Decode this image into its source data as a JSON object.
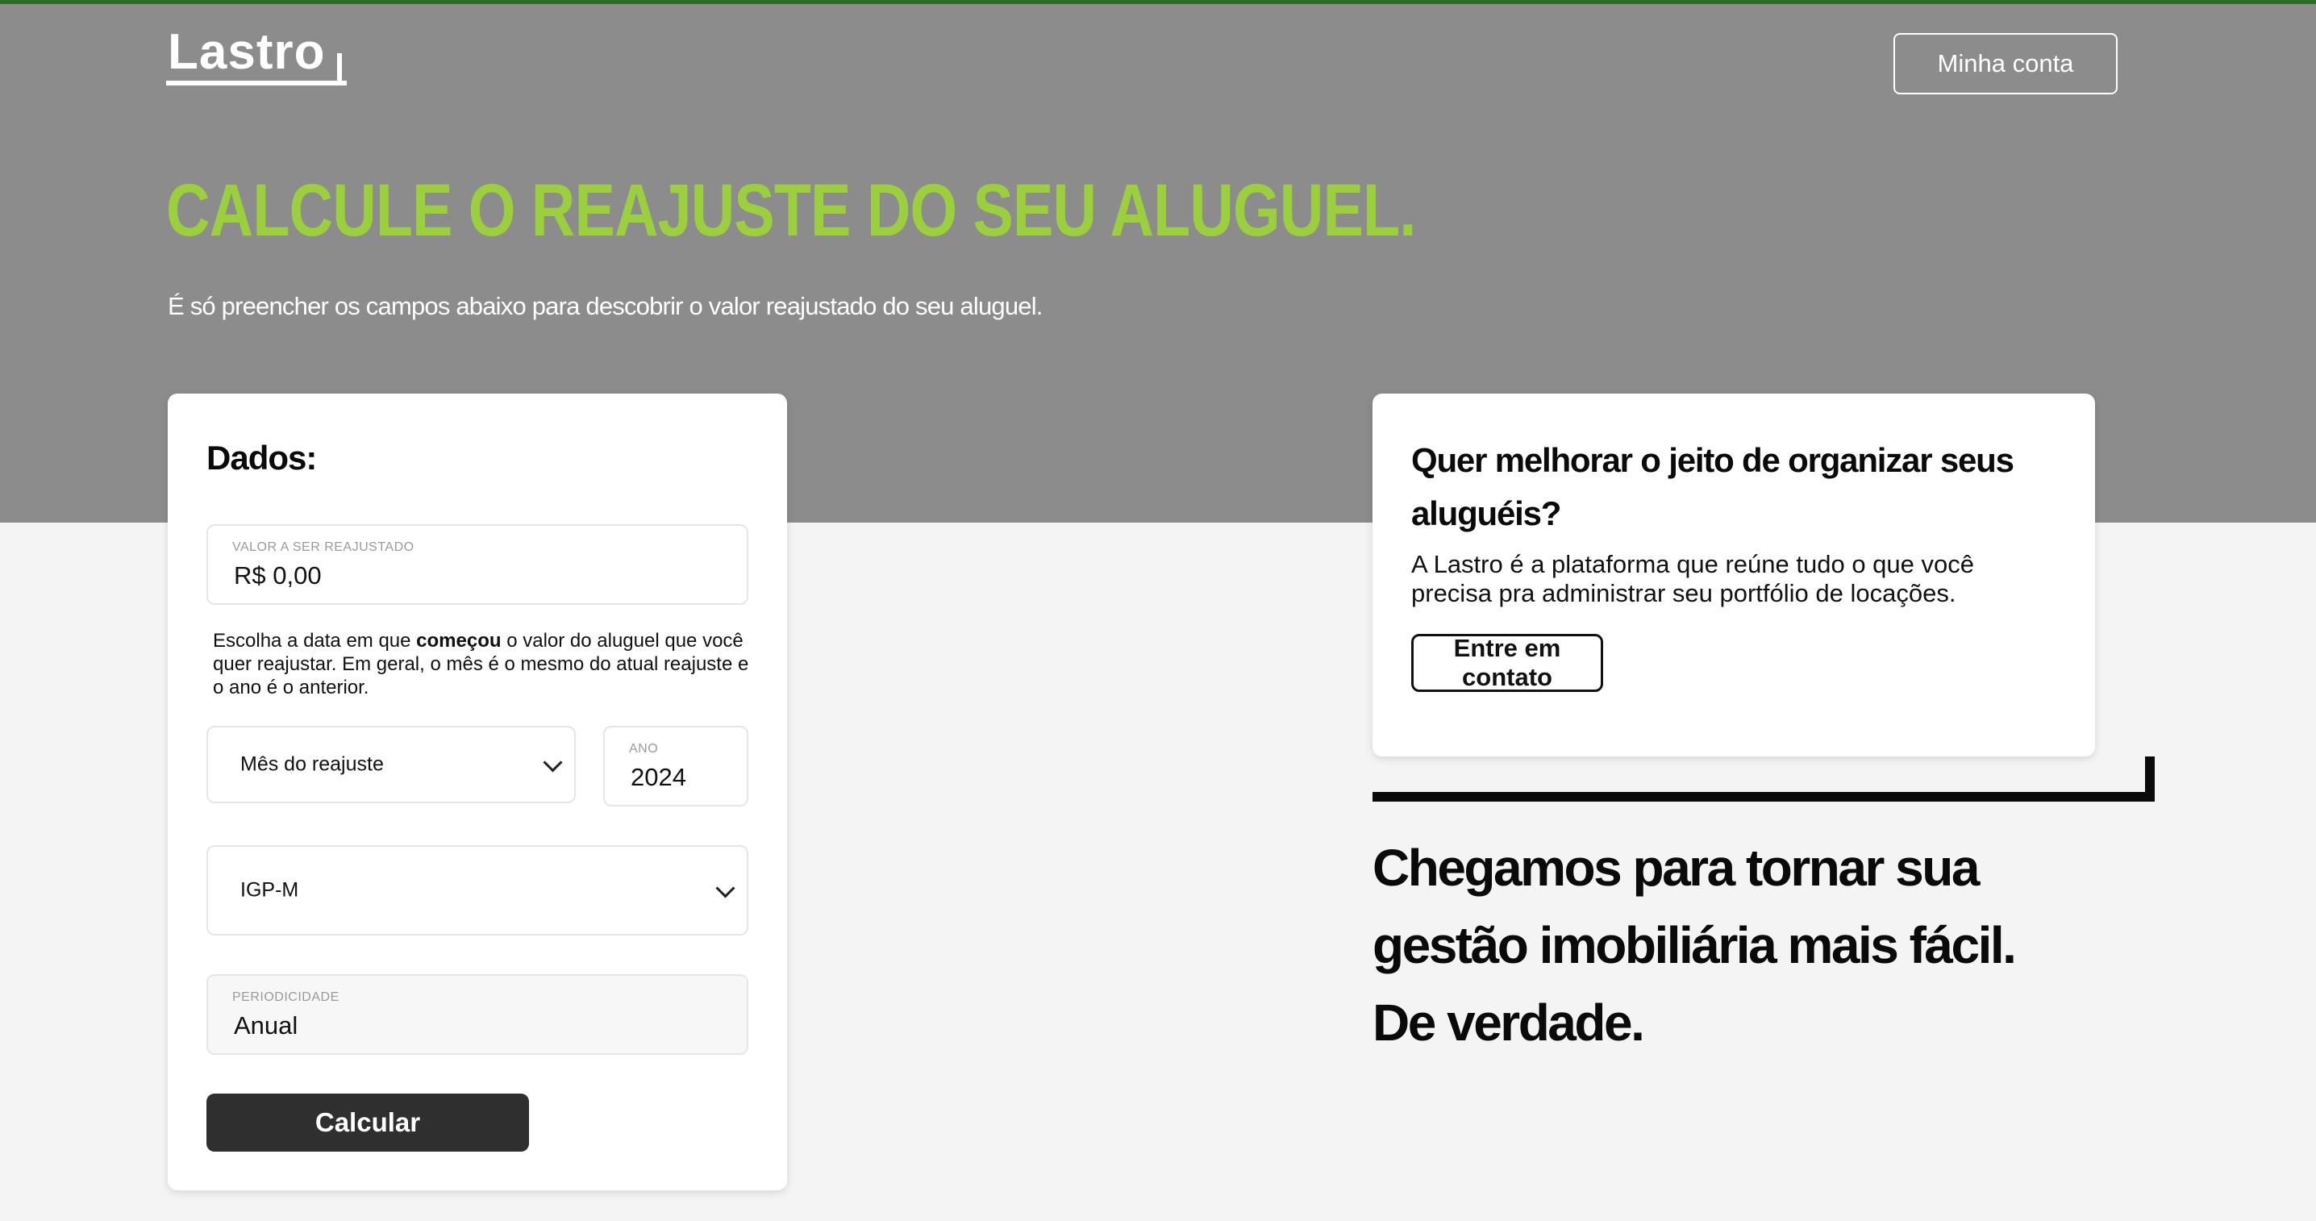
{
  "header": {
    "logo_text": "Lastro",
    "account_button": "Minha conta"
  },
  "hero": {
    "title": "CALCULE O REAJUSTE DO SEU ALUGUEL.",
    "subtitle": "É só preencher os campos abaixo para descobrir o valor reajustado do seu aluguel."
  },
  "form": {
    "title": "Dados:",
    "amount": {
      "label": "VALOR A SER REAJUSTADO",
      "value": "R$ 0,00"
    },
    "hint": {
      "before": "Escolha a data em que ",
      "bold": "começou",
      "after": " o valor do aluguel que você quer reajustar. Em geral, o mês é o mesmo do atual reajuste e o ano é o anterior."
    },
    "month_select": {
      "value": "Mês do reajuste"
    },
    "year": {
      "label": "ANO",
      "value": "2024"
    },
    "index_select": {
      "value": "IGP-M"
    },
    "periodicity": {
      "label": "PERIODICIDADE",
      "value": "Anual"
    },
    "submit_button": "Calcular"
  },
  "promo": {
    "title": "Quer melhorar o jeito de organizar seus aluguéis?",
    "text": "A Lastro é a plataforma que reúne tudo o que você precisa pra administrar seu portfólio de locações.",
    "contact_button": "Entre em contato"
  },
  "tagline": {
    "line1": "Chegamos para tornar sua",
    "line2": "gestão imobiliária mais fácil.",
    "line3": "De verdade."
  },
  "colors": {
    "hero_bg": "#8c8c8c",
    "accent_green": "#9ccf3e",
    "top_border": "#2c6b2c",
    "button_dark": "#2f2f2f",
    "page_bg": "#f4f4f4"
  }
}
